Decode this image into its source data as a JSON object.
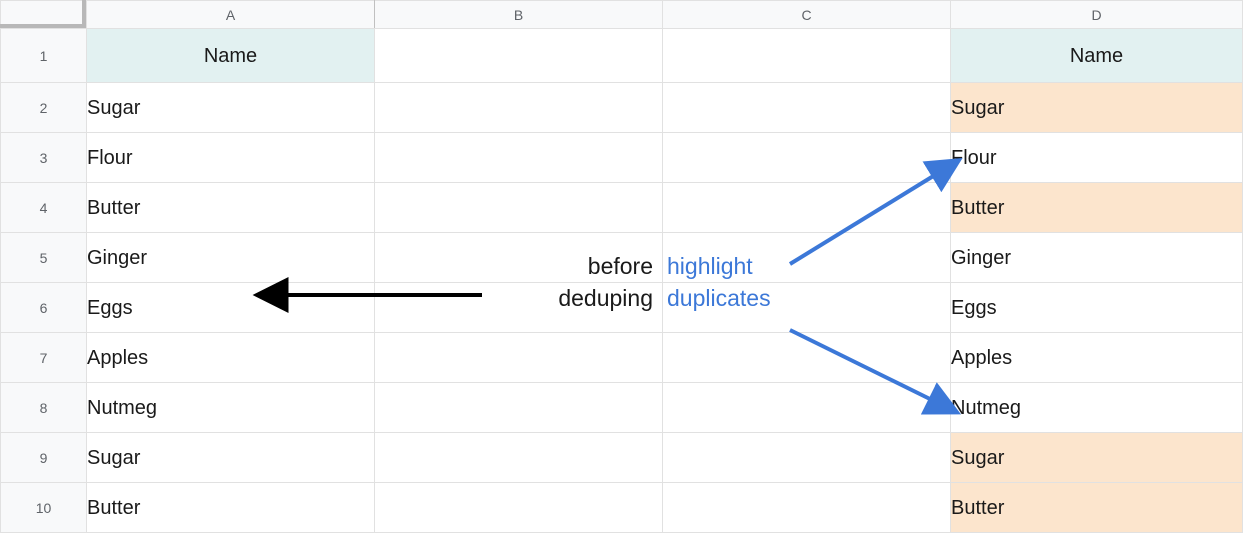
{
  "columns": {
    "A": "A",
    "B": "B",
    "C": "C",
    "D": "D"
  },
  "rows": [
    "1",
    "2",
    "3",
    "4",
    "5",
    "6",
    "7",
    "8",
    "9",
    "10"
  ],
  "headers": {
    "A": "Name",
    "D": "Name"
  },
  "dataA": [
    "Sugar",
    "Flour",
    "Butter",
    "Ginger",
    "Eggs",
    "Apples",
    "Nutmeg",
    "Sugar",
    "Butter"
  ],
  "dataD": [
    {
      "v": "Sugar",
      "hl": true
    },
    {
      "v": "Flour",
      "hl": false
    },
    {
      "v": "Butter",
      "hl": true
    },
    {
      "v": "Ginger",
      "hl": false
    },
    {
      "v": "Eggs",
      "hl": false
    },
    {
      "v": "Apples",
      "hl": false
    },
    {
      "v": "Nutmeg",
      "hl": false
    },
    {
      "v": "Sugar",
      "hl": true
    },
    {
      "v": "Butter",
      "hl": true
    }
  ],
  "annotations": {
    "before": "before",
    "deduping": "deduping",
    "highlight": "highlight",
    "duplicates": "duplicates"
  }
}
